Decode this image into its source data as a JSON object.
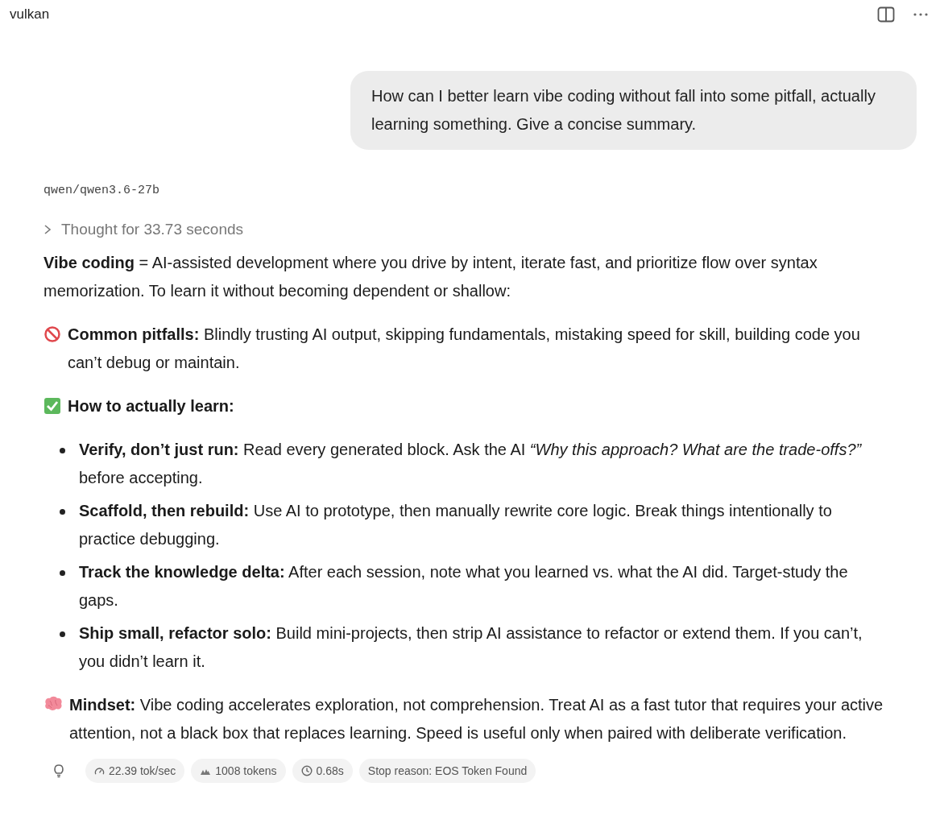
{
  "window": {
    "title": "vulkan"
  },
  "user_message": "How can I better learn vibe coding without fall into some pitfall, actually learning something. Give a concise summary.",
  "response": {
    "model": "qwen/qwen3.6-27b",
    "thought": {
      "label": "Thought for 33.73 seconds",
      "expanded": false
    },
    "blocks": [
      {
        "kind": "paragraph",
        "text": "**Vibe coding** = AI-assisted development where you drive by intent, iterate fast, and prioritize flow over syntax memorization. To learn it without becoming dependent or shallow:"
      },
      {
        "kind": "callout",
        "text": "**Common pitfalls:** Blindly trusting AI output, skipping fundamentals, mistaking speed for skill, building code you can’t debug or maintain."
      },
      {
        "kind": "callout",
        "text": "**How to actually learn:**"
      },
      {
        "kind": "list",
        "items": [
          "**Verify, don’t just run:** Read every generated block. Ask the AI *“Why this approach? What are the trade-offs?”* before accepting.",
          "**Scaffold, then rebuild:** Use AI to prototype, then manually rewrite core logic. Break things intentionally to practice debugging.",
          "**Track the knowledge delta:** After each session, note what you learned vs. what the AI did. Target-study the gaps.",
          "**Ship small, refactor solo:** Build mini-projects, then strip AI assistance to refactor or extend them. If you can’t, you didn’t learn it."
        ]
      },
      {
        "kind": "callout",
        "text": "**Mindset:** Vibe coding accelerates exploration, not comprehension. Treat AI as a fast tutor that requires your active attention, not a black box that replaces learning. Speed is useful only when paired with deliberate verification."
      }
    ],
    "stats": [
      "22.39 tok/sec",
      "1008 tokens",
      "0.68s",
      "Stop reason: EOS Token Found"
    ]
  }
}
